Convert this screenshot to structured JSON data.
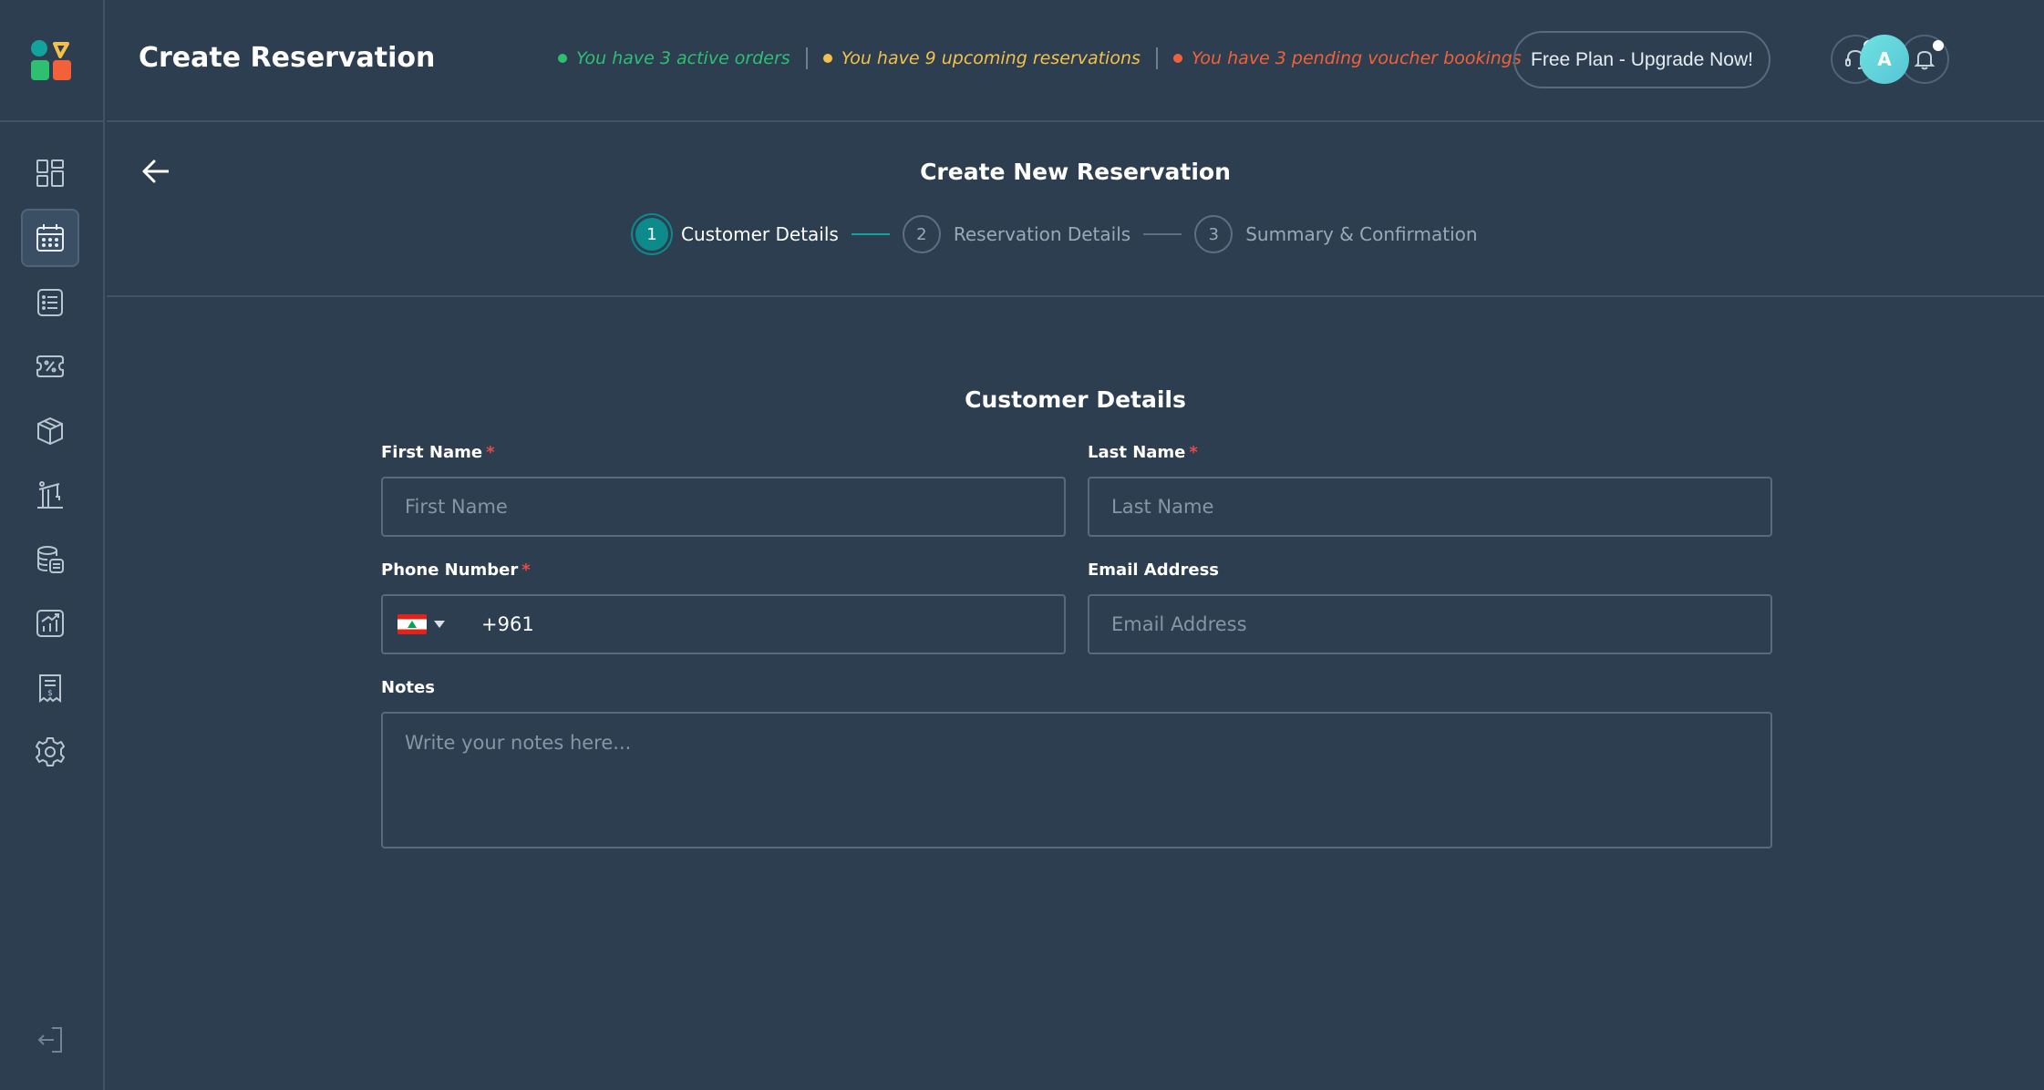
{
  "header": {
    "title": "Create Reservation",
    "statuses": [
      {
        "text": "You have 3 active orders",
        "color": "#2fbf71"
      },
      {
        "text": "You have 9 upcoming reservations",
        "color": "#f3c14b"
      },
      {
        "text": "You have 3 pending voucher bookings",
        "color": "#f2613a"
      }
    ],
    "upgrade_label": "Free Plan - Upgrade Now!",
    "avatar_initial": "A"
  },
  "sidebar": {
    "items": [
      {
        "name": "dashboard-icon",
        "active": false
      },
      {
        "name": "calendar-icon",
        "active": true
      },
      {
        "name": "list-icon",
        "active": false
      },
      {
        "name": "voucher-icon",
        "active": false
      },
      {
        "name": "box-icon",
        "active": false
      },
      {
        "name": "crane-icon",
        "active": false
      },
      {
        "name": "database-icon",
        "active": false
      },
      {
        "name": "analytics-icon",
        "active": false
      },
      {
        "name": "receipt-icon",
        "active": false
      },
      {
        "name": "gear-icon",
        "active": false
      }
    ]
  },
  "subheader": {
    "title": "Create New Reservation",
    "steps": [
      {
        "number": "1",
        "label": "Customer Details",
        "active": true
      },
      {
        "number": "2",
        "label": "Reservation Details",
        "active": false
      },
      {
        "number": "3",
        "label": "Summary & Confirmation",
        "active": false
      }
    ]
  },
  "form": {
    "title": "Customer Details",
    "first_name": {
      "label": "First Name",
      "placeholder": "First Name",
      "required": true
    },
    "last_name": {
      "label": "Last Name",
      "placeholder": "Last Name",
      "required": true
    },
    "phone": {
      "label": "Phone Number",
      "value": "+961",
      "required": true
    },
    "email": {
      "label": "Email Address",
      "placeholder": "Email Address"
    },
    "notes": {
      "label": "Notes",
      "placeholder": "Write your notes here..."
    },
    "required_mark": "*"
  }
}
